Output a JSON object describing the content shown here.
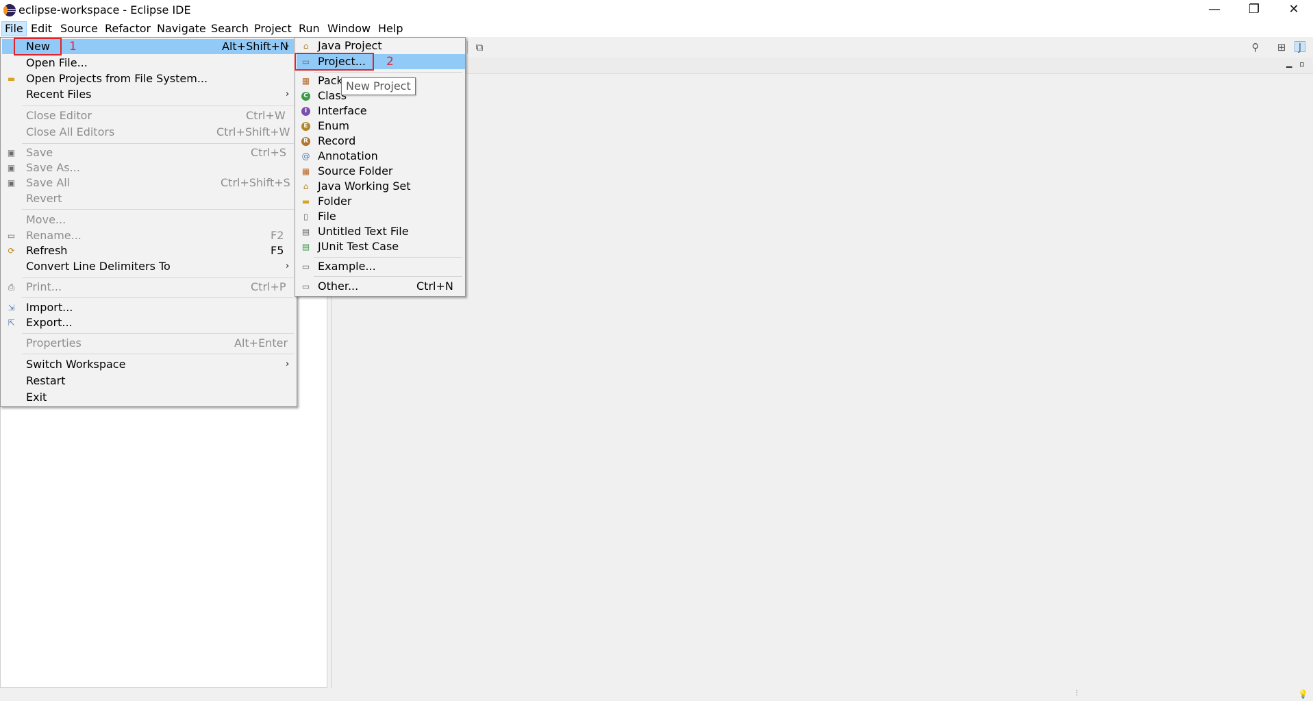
{
  "window": {
    "title": "eclipse-workspace - Eclipse IDE",
    "minimize": "—",
    "restore": "❐",
    "close": "✕"
  },
  "menubar": [
    "File",
    "Edit",
    "Source",
    "Refactor",
    "Navigate",
    "Search",
    "Project",
    "Run",
    "Window",
    "Help"
  ],
  "file_menu": {
    "new": {
      "label": "New",
      "shortcut": "Alt+Shift+N"
    },
    "open_file": "Open File...",
    "open_projects": "Open Projects from File System...",
    "recent_files": "Recent Files",
    "close_editor": {
      "label": "Close Editor",
      "shortcut": "Ctrl+W"
    },
    "close_all": {
      "label": "Close All Editors",
      "shortcut": "Ctrl+Shift+W"
    },
    "save": {
      "label": "Save",
      "shortcut": "Ctrl+S"
    },
    "save_as": "Save As...",
    "save_all": {
      "label": "Save All",
      "shortcut": "Ctrl+Shift+S"
    },
    "revert": "Revert",
    "move": "Move...",
    "rename": {
      "label": "Rename...",
      "shortcut": "F2"
    },
    "refresh": {
      "label": "Refresh",
      "shortcut": "F5"
    },
    "convert": "Convert Line Delimiters To",
    "print": {
      "label": "Print...",
      "shortcut": "Ctrl+P"
    },
    "import": "Import...",
    "export": "Export...",
    "properties": {
      "label": "Properties",
      "shortcut": "Alt+Enter"
    },
    "switch_ws": "Switch Workspace",
    "restart": "Restart",
    "exit": "Exit"
  },
  "new_submenu": {
    "java_project": "Java Project",
    "project": "Project...",
    "package": "Pack",
    "class": "Class",
    "interface": "Interface",
    "enum": "Enum",
    "record": "Record",
    "annotation": "Annotation",
    "source_folder": "Source Folder",
    "working_set": "Java Working Set",
    "folder": "Folder",
    "file": "File",
    "untitled": "Untitled Text File",
    "junit": "JUnit Test Case",
    "example": "Example...",
    "other": {
      "label": "Other...",
      "shortcut": "Ctrl+N"
    }
  },
  "tooltip": "New Project",
  "annotations": {
    "step1": "1",
    "step2": "2"
  },
  "colors": {
    "highlight": "#91c9f7",
    "annotation": "#e1242a"
  }
}
